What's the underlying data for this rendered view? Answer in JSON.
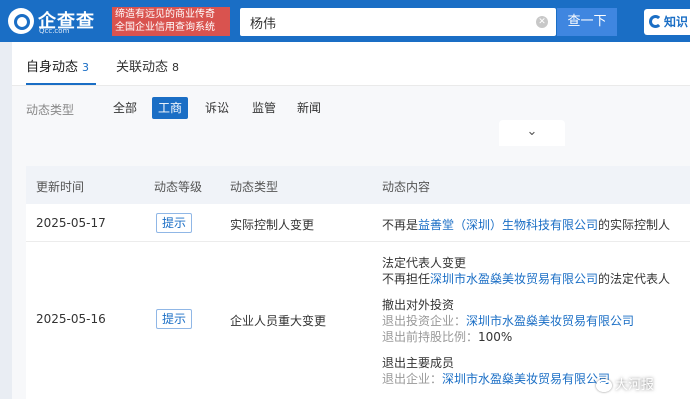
{
  "header": {
    "logo_text": "企查查",
    "logo_sub": "Qcc.com",
    "slogan_line1": "缔造有远见的商业传奇",
    "slogan_line2": "全国企业信用查询系统",
    "search_value": "杨伟",
    "search_button": "查一下",
    "know_button": "知识",
    "colors": {
      "brand": "#1a6ec5",
      "slogan_bg": "#d9534f"
    }
  },
  "tabs": [
    {
      "label": "自身动态",
      "count": "3"
    },
    {
      "label": "关联动态",
      "count": "8"
    }
  ],
  "filter": {
    "label": "动态类型",
    "chips": [
      "全部",
      "工商",
      "诉讼",
      "监管",
      "新闻"
    ],
    "active": "工商",
    "expand_icon": "chevron-down-icon"
  },
  "table": {
    "headers": [
      "更新时间",
      "动态等级",
      "动态类型",
      "动态内容"
    ],
    "rows": [
      {
        "date": "2025-05-17",
        "level": "提示",
        "type": "实际控制人变更",
        "content": {
          "prefix": "不再是",
          "company": "益善堂（深圳）生物科技有限公司",
          "suffix": "的实际控制人"
        }
      },
      {
        "date": "2025-05-16",
        "level": "提示",
        "type": "企业人员重大变更",
        "blocks": [
          {
            "title": "法定代表人变更",
            "line_prefix": "不再担任",
            "line_company": "深圳市水盈燊美妆贸易有限公司",
            "line_suffix": "的法定代表人"
          },
          {
            "title": "撤出对外投资",
            "line1_label": "退出投资企业：",
            "line1_company": "深圳市水盈燊美妆贸易有限公司",
            "line2_label": "退出前持股比例：",
            "line2_value": "100%"
          },
          {
            "title": "退出主要成员",
            "line_label": "退出企业：",
            "line_company": "深圳市水盈燊美妆贸易有限公司"
          }
        ]
      }
    ]
  },
  "watermark": "大河报"
}
